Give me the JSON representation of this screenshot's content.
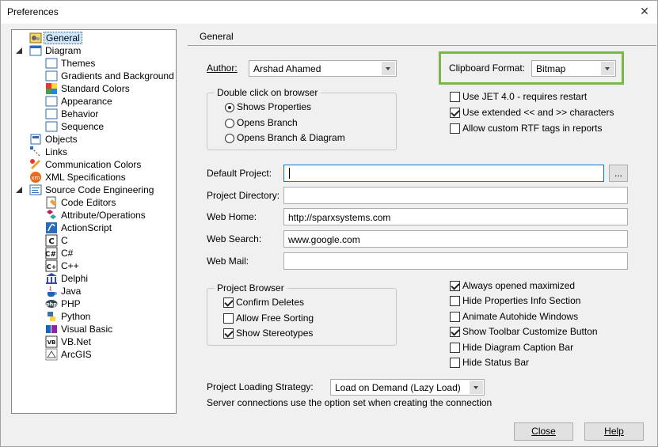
{
  "window": {
    "title": "Preferences"
  },
  "tree": {
    "items": [
      {
        "label": "General",
        "icon": "general-icon"
      },
      {
        "label": "Diagram",
        "icon": "diagram-icon"
      },
      {
        "label": "Themes",
        "icon": "themes-icon"
      },
      {
        "label": "Gradients and Background",
        "icon": "gradients-icon"
      },
      {
        "label": "Standard Colors",
        "icon": "standard-colors-icon"
      },
      {
        "label": "Appearance",
        "icon": "appearance-icon"
      },
      {
        "label": "Behavior",
        "icon": "behavior-icon"
      },
      {
        "label": "Sequence",
        "icon": "sequence-icon"
      },
      {
        "label": "Objects",
        "icon": "objects-icon"
      },
      {
        "label": "Links",
        "icon": "links-icon"
      },
      {
        "label": "Communication Colors",
        "icon": "communication-colors-icon"
      },
      {
        "label": "XML Specifications",
        "icon": "xml-icon"
      },
      {
        "label": "Source Code Engineering",
        "icon": "source-code-icon"
      },
      {
        "label": "Code Editors",
        "icon": "code-editors-icon"
      },
      {
        "label": "Attribute/Operations",
        "icon": "attribute-operations-icon"
      },
      {
        "label": "ActionScript",
        "icon": "actionscript-icon"
      },
      {
        "label": "C",
        "icon": "c-icon"
      },
      {
        "label": "C#",
        "icon": "csharp-icon"
      },
      {
        "label": "C++",
        "icon": "cpp-icon"
      },
      {
        "label": "Delphi",
        "icon": "delphi-icon"
      },
      {
        "label": "Java",
        "icon": "java-icon"
      },
      {
        "label": "PHP",
        "icon": "php-icon"
      },
      {
        "label": "Python",
        "icon": "python-icon"
      },
      {
        "label": "Visual Basic",
        "icon": "visual-basic-icon"
      },
      {
        "label": "VB.Net",
        "icon": "vbnet-icon"
      },
      {
        "label": "ArcGIS",
        "icon": "arcgis-icon"
      }
    ]
  },
  "panel": {
    "title": "General",
    "author": {
      "label": "Author:",
      "value": "Arshad Ahamed"
    },
    "double_click": {
      "title": "Double click on browser",
      "options": [
        "Shows Properties",
        "Opens Branch",
        "Opens Branch  & Diagram"
      ],
      "selected": "Shows Properties"
    },
    "clipboard": {
      "label": "Clipboard Format:",
      "value": "Bitmap"
    },
    "top_checks": [
      {
        "label": "Use JET 4.0 - requires restart",
        "checked": false
      },
      {
        "label": "Use extended << and >> characters",
        "checked": true
      },
      {
        "label": "Allow custom RTF tags in reports",
        "checked": false
      }
    ],
    "fields": [
      {
        "label": "Default Project:",
        "value": ""
      },
      {
        "label": "Project Directory:",
        "value": ""
      },
      {
        "label": "Web Home:",
        "value": "http://sparxsystems.com"
      },
      {
        "label": "Web Search:",
        "value": "www.google.com"
      },
      {
        "label": "Web Mail:",
        "value": ""
      }
    ],
    "browse_label": "...",
    "project_browser": {
      "title": "Project Browser",
      "checks": [
        {
          "label": "Confirm Deletes",
          "checked": true
        },
        {
          "label": "Allow Free Sorting",
          "checked": false
        },
        {
          "label": "Show Stereotypes",
          "checked": true
        }
      ]
    },
    "right_checks": [
      {
        "label": "Always opened maximized",
        "checked": true
      },
      {
        "label": "Hide Properties Info Section",
        "checked": false
      },
      {
        "label": "Animate Autohide Windows",
        "checked": false
      },
      {
        "label": "Show Toolbar Customize Button",
        "checked": true
      },
      {
        "label": "Hide Diagram Caption Bar",
        "checked": false
      },
      {
        "label": "Hide Status Bar",
        "checked": false
      }
    ],
    "loading": {
      "label": "Project Loading Strategy:",
      "value": "Load on Demand (Lazy Load)",
      "note": "Server connections use the option set when creating the connection"
    }
  },
  "buttons": {
    "close": "Close",
    "help": "Help"
  },
  "colors": {
    "highlight": "#7ab648",
    "selection": "#cce8ff"
  }
}
